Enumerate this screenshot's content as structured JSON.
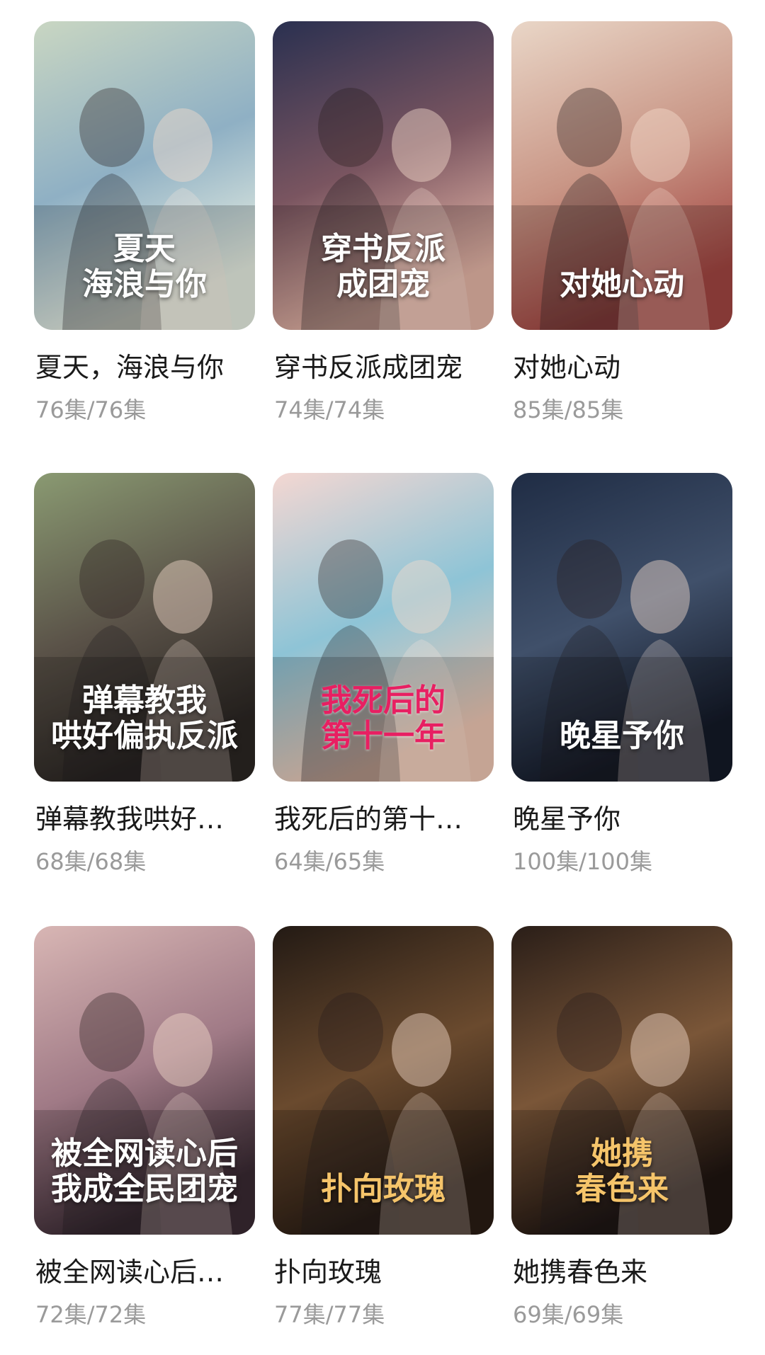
{
  "dramas": [
    {
      "name": "夏天，海浪与你",
      "count": "76集/76集",
      "poster_text": "夏天\n海浪与你",
      "style": "light",
      "icon": "drama-poster-1",
      "colors": {
        "top": "#c9d6c2",
        "mid": "#8fb0c4",
        "bottom": "#e8efe3"
      }
    },
    {
      "name": "穿书反派成团宠",
      "count": "74集/74集",
      "poster_text": "穿书反派\n成团宠",
      "style": "light",
      "icon": "drama-poster-2",
      "colors": {
        "top": "#2a3050",
        "mid": "#7a5560",
        "bottom": "#e7b7a8"
      }
    },
    {
      "name": "对她心动",
      "count": "85集/85集",
      "poster_text": "对她心动",
      "style": "light",
      "icon": "drama-poster-3",
      "colors": {
        "top": "#e9d6c7",
        "mid": "#c99686",
        "bottom": "#a34642"
      }
    },
    {
      "name": "弹幕教我哄好…",
      "count": "68集/68集",
      "poster_text": "弹幕教我\n哄好偏执反派",
      "style": "light",
      "icon": "drama-poster-4",
      "colors": {
        "top": "#8a9a72",
        "mid": "#5a5248",
        "bottom": "#2b2623"
      }
    },
    {
      "name": "我死后的第十…",
      "count": "64集/65集",
      "poster_text": "我死后的\n第十一年",
      "style": "pink",
      "icon": "drama-poster-5",
      "colors": {
        "top": "#f4d7d2",
        "mid": "#8ec4d6",
        "bottom": "#f1c9b5"
      }
    },
    {
      "name": "晚星予你",
      "count": "100集/100集",
      "poster_text": "晚星予你",
      "style": "light",
      "icon": "drama-poster-6",
      "colors": {
        "top": "#1f2c44",
        "mid": "#40506a",
        "bottom": "#141a28"
      }
    },
    {
      "name": "被全网读心后…",
      "count": "72集/72集",
      "poster_text": "被全网读心后\n我成全民团宠",
      "style": "light",
      "icon": "drama-poster-7",
      "colors": {
        "top": "#d8b6b4",
        "mid": "#a07a86",
        "bottom": "#3a2a33"
      }
    },
    {
      "name": "扑向玫瑰",
      "count": "77集/77集",
      "poster_text": "扑向玫瑰",
      "style": "gold",
      "icon": "drama-poster-8",
      "colors": {
        "top": "#231a14",
        "mid": "#6a4a2e",
        "bottom": "#2a1d14"
      }
    },
    {
      "name": "她携春色来",
      "count": "69集/69集",
      "poster_text": "她携\n春色来",
      "style": "gold",
      "icon": "drama-poster-9",
      "colors": {
        "top": "#2a1e18",
        "mid": "#7a5638",
        "bottom": "#1f1511"
      }
    }
  ]
}
